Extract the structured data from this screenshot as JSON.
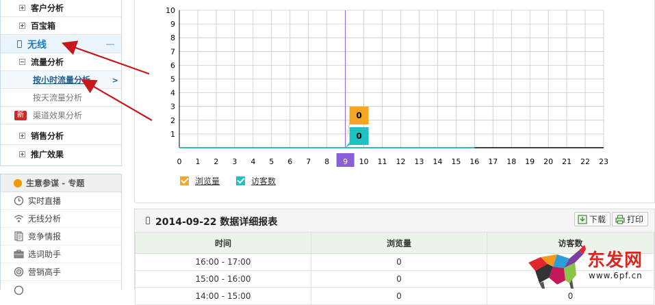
{
  "sidebar": {
    "items": [
      {
        "label": "客户分析",
        "expander": "plus"
      },
      {
        "label": "百宝箱",
        "expander": "plus"
      }
    ],
    "wireless": {
      "label": "无线",
      "icon": "phone-icon"
    },
    "traffic": {
      "label": "流量分析",
      "expander": "minus",
      "sub": [
        {
          "label": "按小时流量分析",
          "active": true
        },
        {
          "label": "按天流量分析",
          "active": false
        }
      ]
    },
    "channel": {
      "badge": "新",
      "label": "渠道效果分析"
    },
    "items2": [
      {
        "label": "销售分析"
      },
      {
        "label": "推广效果"
      }
    ]
  },
  "tools": {
    "header": "生意参谋 - 专题",
    "items": [
      {
        "label": "实时直播",
        "icon": "clock-icon"
      },
      {
        "label": "无线分析",
        "icon": "wifi-icon"
      },
      {
        "label": "竞争情报",
        "icon": "document-icon"
      },
      {
        "label": "选词助手",
        "icon": "briefcase-icon"
      },
      {
        "label": "营销高手",
        "icon": "target-icon"
      }
    ]
  },
  "colors": {
    "pv": "#f5a623",
    "uv": "#1fc1c3",
    "highlight": "#8a5fd6",
    "accent": "#1e7fbf"
  },
  "chart_data": {
    "type": "line",
    "x": [
      0,
      1,
      2,
      3,
      4,
      5,
      6,
      7,
      8,
      9,
      10,
      11,
      12,
      13,
      14,
      15,
      16,
      17,
      18,
      19,
      20,
      21,
      22,
      23
    ],
    "xlim": [
      0,
      23
    ],
    "ylim": [
      0,
      10
    ],
    "yticks": [
      1,
      2,
      3,
      4,
      5,
      6,
      7,
      8,
      9,
      10
    ],
    "highlight_x": 9,
    "grid": true,
    "legend": "bottom-left",
    "series": [
      {
        "name": "浏览量",
        "values": [
          0,
          0,
          0,
          0,
          0,
          0,
          0,
          0,
          0,
          0,
          0,
          0,
          0,
          0,
          0,
          0,
          0,
          null,
          null,
          null,
          null,
          null,
          null,
          null
        ]
      },
      {
        "name": "访客数",
        "values": [
          0,
          0,
          0,
          0,
          0,
          0,
          0,
          0,
          0,
          0,
          0,
          0,
          0,
          0,
          0,
          0,
          0,
          null,
          null,
          null,
          null,
          null,
          null,
          null
        ]
      }
    ],
    "tooltips": [
      {
        "series": "浏览量",
        "x": 9,
        "value": 0
      },
      {
        "series": "访客数",
        "x": 9,
        "value": 0
      }
    ]
  },
  "report": {
    "title": "2014-09-22 数据详细报表",
    "download_label": "下载",
    "print_label": "打印",
    "columns": [
      "时间",
      "浏览量",
      "访客数"
    ],
    "rows": [
      [
        "16:00 - 17:00",
        "0",
        "0"
      ],
      [
        "15:00 - 16:00",
        "0",
        "0"
      ],
      [
        "14:00 - 15:00",
        "0",
        "0"
      ]
    ]
  },
  "logo": {
    "name": "东发网",
    "url": "www.6pf.cn"
  }
}
